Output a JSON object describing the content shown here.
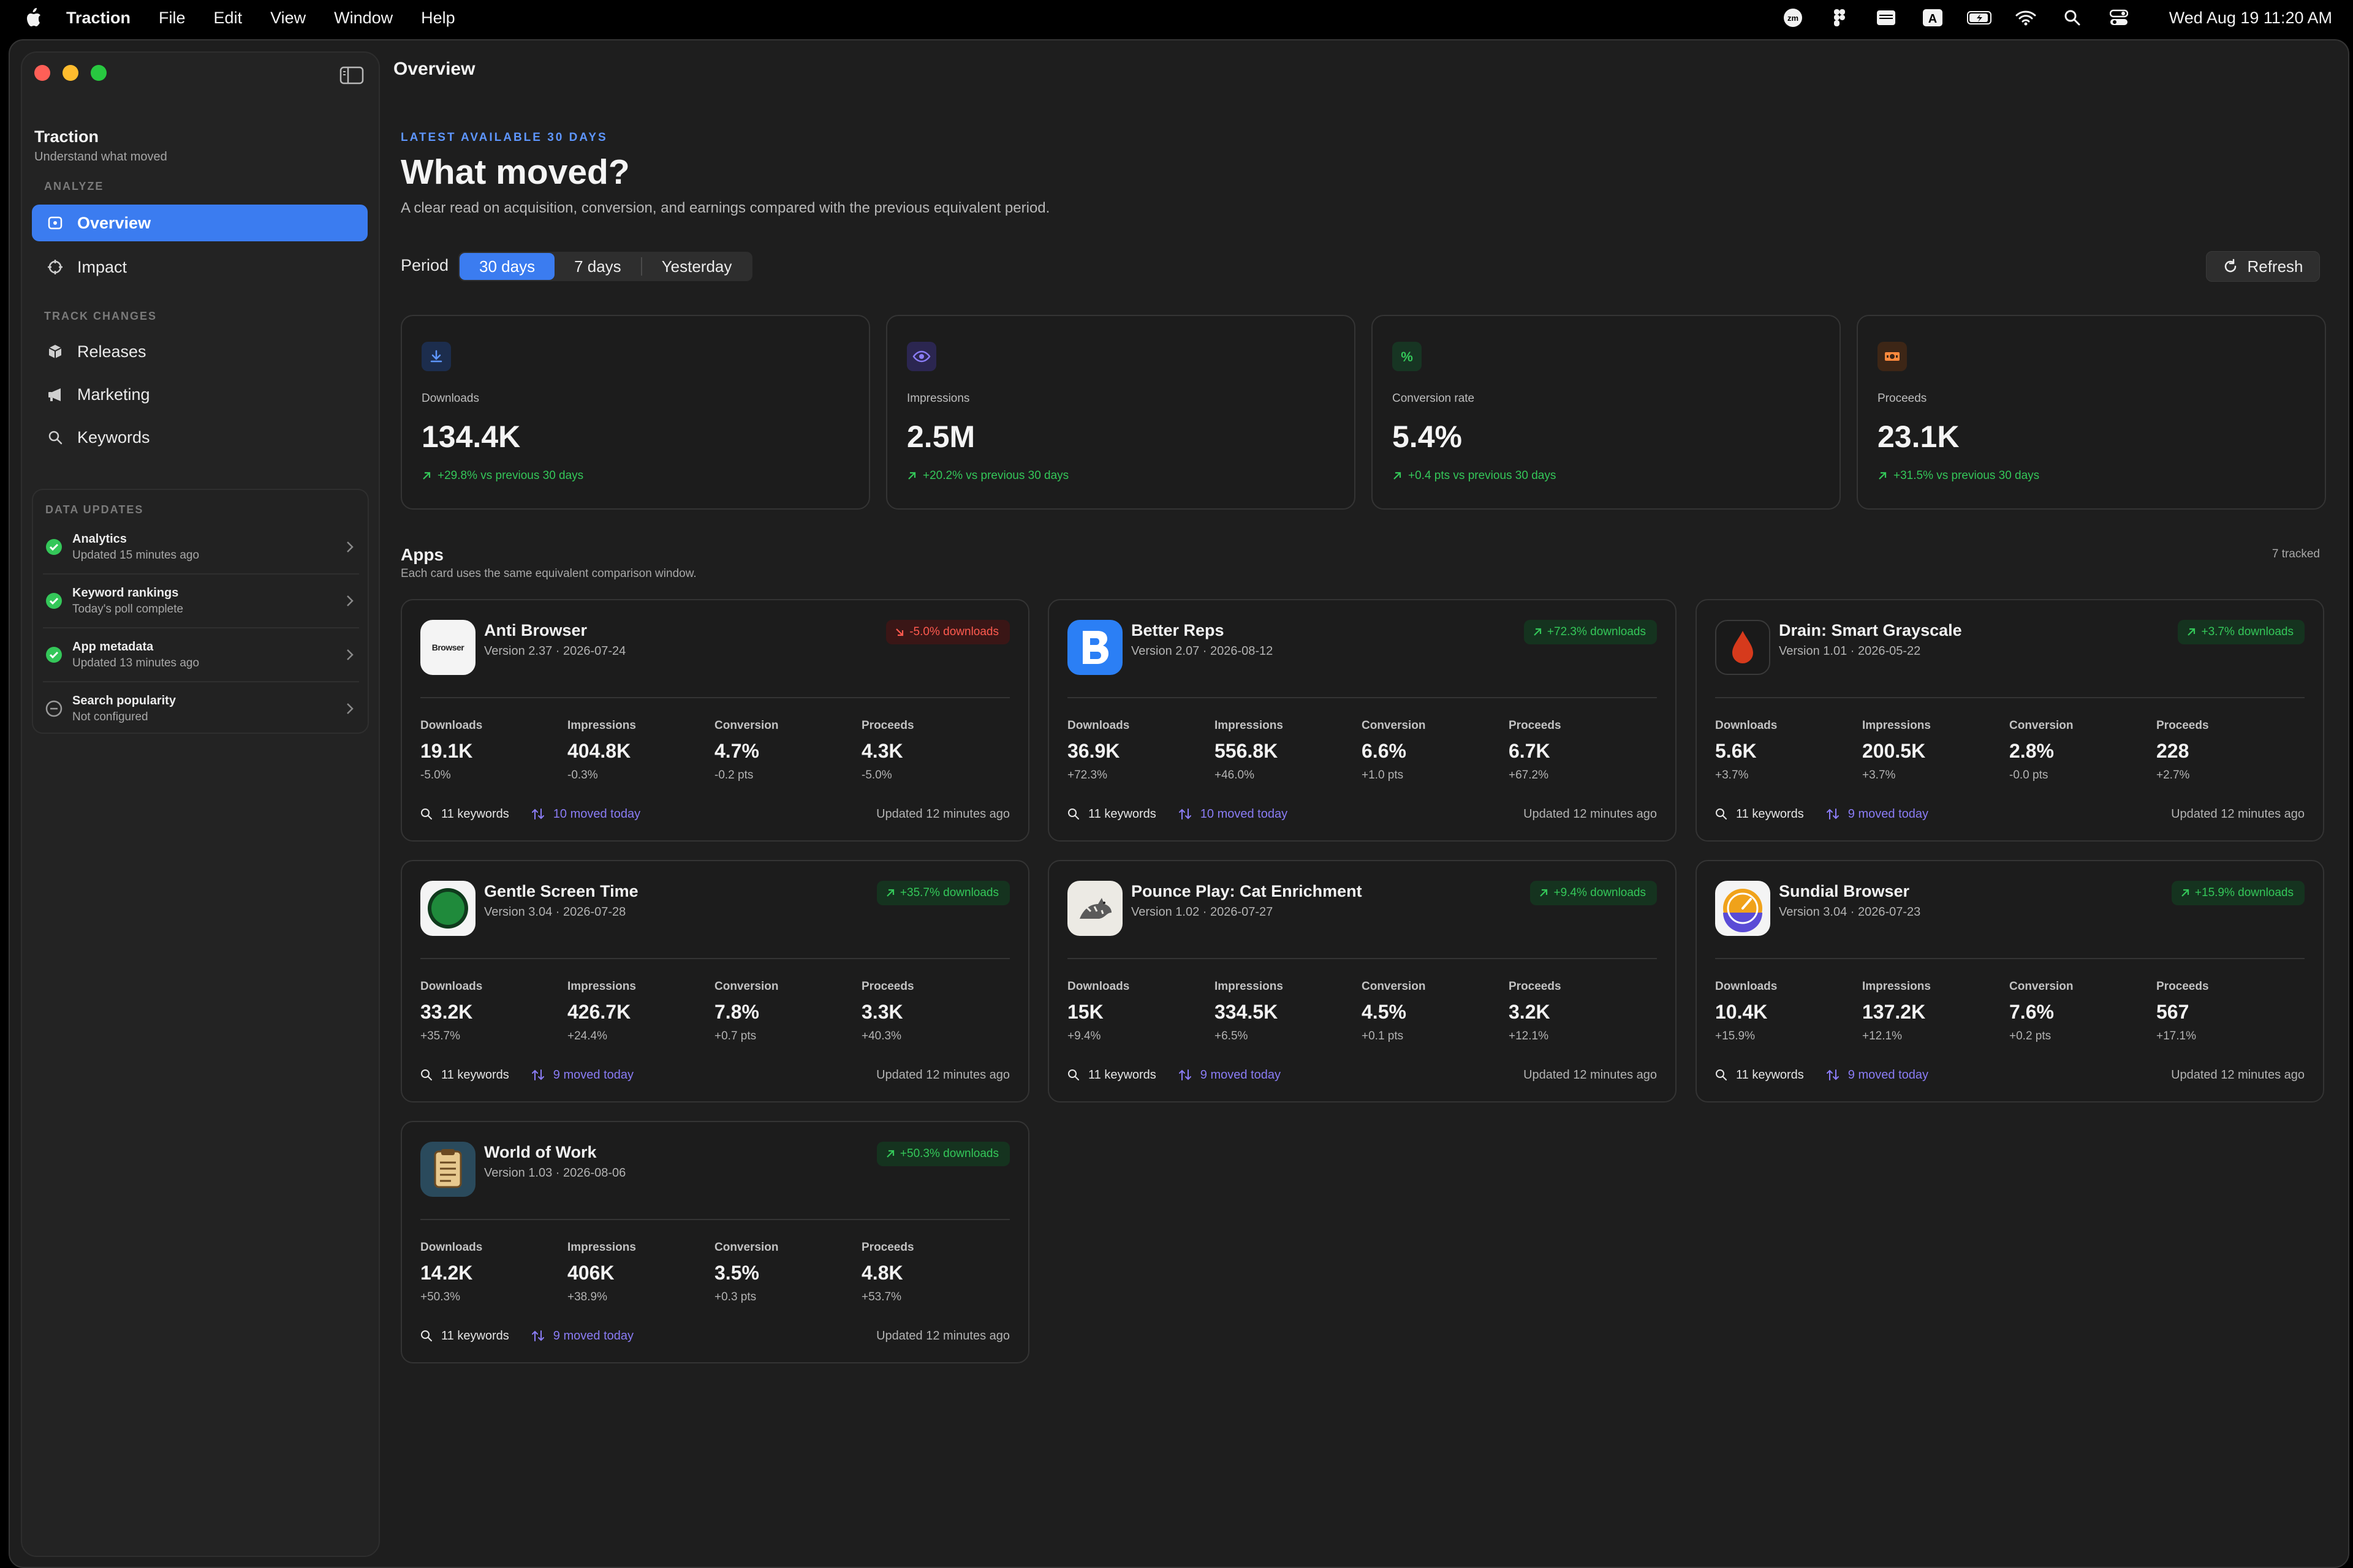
{
  "menubar": {
    "app_name": "Traction",
    "items": [
      "File",
      "Edit",
      "View",
      "Window",
      "Help"
    ],
    "clock": "Wed Aug 19  11:20 AM"
  },
  "sidebar": {
    "brand_name": "Traction",
    "brand_sub": "Understand what moved",
    "analyze_label": "ANALYZE",
    "analyze_items": [
      {
        "label": "Overview",
        "icon": "overview-icon"
      },
      {
        "label": "Impact",
        "icon": "target-icon"
      }
    ],
    "track_label": "TRACK CHANGES",
    "track_items": [
      {
        "label": "Releases",
        "icon": "box-icon"
      },
      {
        "label": "Marketing",
        "icon": "megaphone-icon"
      },
      {
        "label": "Keywords",
        "icon": "search-icon"
      }
    ],
    "updates_label": "DATA UPDATES",
    "updates": [
      {
        "title": "Analytics",
        "sub": "Updated 15 minutes ago",
        "status": "ok"
      },
      {
        "title": "Keyword rankings",
        "sub": "Today's poll complete",
        "status": "ok"
      },
      {
        "title": "App metadata",
        "sub": "Updated 13 minutes ago",
        "status": "ok"
      },
      {
        "title": "Search popularity",
        "sub": "Not configured",
        "status": "off"
      }
    ]
  },
  "main": {
    "title": "Overview",
    "eyebrow": "LATEST AVAILABLE 30 DAYS",
    "headline": "What moved?",
    "subhead": "A clear read on acquisition, conversion, and earnings compared with the previous equivalent period.",
    "period_label": "Period",
    "periods": [
      "30 days",
      "7 days",
      "Yesterday"
    ],
    "active_period": "30 days",
    "refresh_label": "Refresh"
  },
  "kpis": [
    {
      "label": "Downloads",
      "value": "134.4K",
      "delta": "+29.8% vs previous 30 days",
      "icon": "download-icon",
      "color": "#3b7cf0"
    },
    {
      "label": "Impressions",
      "value": "2.5M",
      "delta": "+20.2% vs previous 30 days",
      "icon": "eye-icon",
      "color": "#8a7cf5"
    },
    {
      "label": "Conversion rate",
      "value": "5.4%",
      "delta": "+0.4 pts vs previous 30 days",
      "icon": "percent-icon",
      "color": "#34c759"
    },
    {
      "label": "Proceeds",
      "value": "23.1K",
      "delta": "+31.5% vs previous 30 days",
      "icon": "cash-icon",
      "color": "#ff8a3d"
    }
  ],
  "apps_section": {
    "title": "Apps",
    "sub": "Each card uses the same equivalent comparison window.",
    "count": "7 tracked"
  },
  "metric_labels": [
    "Downloads",
    "Impressions",
    "Conversion",
    "Proceeds"
  ],
  "apps": [
    {
      "name": "Anti Browser",
      "version": "Version 2.37 · 2026-07-24",
      "badge": "-5.0% downloads",
      "trend": "down",
      "icon_text": "Browser",
      "metrics": [
        [
          "19.1K",
          "-5.0%"
        ],
        [
          "404.8K",
          "-0.3%"
        ],
        [
          "4.7%",
          "-0.2 pts"
        ],
        [
          "4.3K",
          "-5.0%"
        ]
      ],
      "keywords": "11 keywords",
      "moved": "10 moved today",
      "updated": "Updated 12 minutes ago"
    },
    {
      "name": "Better Reps",
      "version": "Version 2.07 · 2026-08-12",
      "badge": "+72.3% downloads",
      "trend": "up",
      "metrics": [
        [
          "36.9K",
          "+72.3%"
        ],
        [
          "556.8K",
          "+46.0%"
        ],
        [
          "6.6%",
          "+1.0 pts"
        ],
        [
          "6.7K",
          "+67.2%"
        ]
      ],
      "keywords": "11 keywords",
      "moved": "10 moved today",
      "updated": "Updated 12 minutes ago"
    },
    {
      "name": "Drain: Smart Grayscale",
      "version": "Version 1.01 · 2026-05-22",
      "badge": "+3.7% downloads",
      "trend": "up",
      "metrics": [
        [
          "5.6K",
          "+3.7%"
        ],
        [
          "200.5K",
          "+3.7%"
        ],
        [
          "2.8%",
          "-0.0 pts"
        ],
        [
          "228",
          "+2.7%"
        ]
      ],
      "keywords": "11 keywords",
      "moved": "9 moved today",
      "updated": "Updated 12 minutes ago"
    },
    {
      "name": "Gentle Screen Time",
      "version": "Version 3.04 · 2026-07-28",
      "badge": "+35.7% downloads",
      "trend": "up",
      "metrics": [
        [
          "33.2K",
          "+35.7%"
        ],
        [
          "426.7K",
          "+24.4%"
        ],
        [
          "7.8%",
          "+0.7 pts"
        ],
        [
          "3.3K",
          "+40.3%"
        ]
      ],
      "keywords": "11 keywords",
      "moved": "9 moved today",
      "updated": "Updated 12 minutes ago"
    },
    {
      "name": "Pounce Play: Cat Enrichment",
      "version": "Version 1.02 · 2026-07-27",
      "badge": "+9.4% downloads",
      "trend": "up",
      "metrics": [
        [
          "15K",
          "+9.4%"
        ],
        [
          "334.5K",
          "+6.5%"
        ],
        [
          "4.5%",
          "+0.1 pts"
        ],
        [
          "3.2K",
          "+12.1%"
        ]
      ],
      "keywords": "11 keywords",
      "moved": "9 moved today",
      "updated": "Updated 12 minutes ago"
    },
    {
      "name": "Sundial Browser",
      "version": "Version 3.04 · 2026-07-23",
      "badge": "+15.9% downloads",
      "trend": "up",
      "metrics": [
        [
          "10.4K",
          "+15.9%"
        ],
        [
          "137.2K",
          "+12.1%"
        ],
        [
          "7.6%",
          "+0.2 pts"
        ],
        [
          "567",
          "+17.1%"
        ]
      ],
      "keywords": "11 keywords",
      "moved": "9 moved today",
      "updated": "Updated 12 minutes ago"
    },
    {
      "name": "World of Work",
      "version": "Version 1.03 · 2026-08-06",
      "badge": "+50.3% downloads",
      "trend": "up",
      "metrics": [
        [
          "14.2K",
          "+50.3%"
        ],
        [
          "406K",
          "+38.9%"
        ],
        [
          "3.5%",
          "+0.3 pts"
        ],
        [
          "4.8K",
          "+53.7%"
        ]
      ],
      "keywords": "11 keywords",
      "moved": "9 moved today",
      "updated": "Updated 12 minutes ago"
    }
  ]
}
